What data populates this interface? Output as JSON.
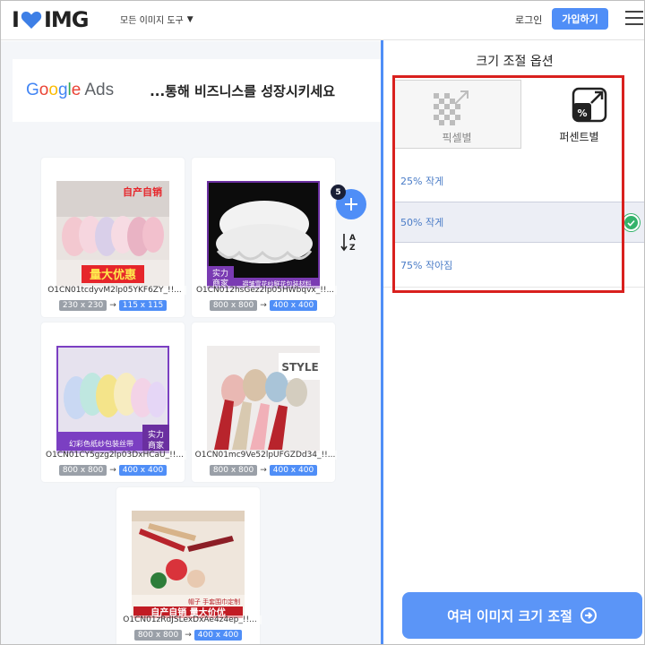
{
  "header": {
    "logo_left": "I",
    "logo_right": "IMG",
    "tools_label": "모든 이미지 도구",
    "login_label": "로그인",
    "signup_label": "가입하기"
  },
  "ad": {
    "logo_letters": [
      "G",
      "o",
      "o",
      "g",
      "l",
      "e"
    ],
    "logo_suffix": "Ads",
    "text": "...통해 비즈니스를 성장시키세요"
  },
  "file_count": "5",
  "cards": [
    {
      "filename": "O1CN01tcdyvM2lp05YKF6ZY_!!...",
      "orig_size": "230 x 230",
      "new_size": "115 x 115"
    },
    {
      "filename": "O1CN012hsGez2lp05HWbqvx_!!...",
      "orig_size": "800 x 800",
      "new_size": "400 x 400"
    },
    {
      "filename": "O1CN01CY5gzg2lp03DxHCaU_!!...",
      "orig_size": "800 x 800",
      "new_size": "400 x 400"
    },
    {
      "filename": "O1CN01mc9Ve52lpUFGZDd34_!!...",
      "orig_size": "800 x 800",
      "new_size": "400 x 400"
    },
    {
      "filename": "O1CN01zRdJSLexDxAe4z4ep_!!...",
      "orig_size": "800 x 800",
      "new_size": "400 x 400"
    }
  ],
  "thumb_text": {
    "card1_banner": "自产自销",
    "card1_badge": "量大优惠",
    "card2_badge": "实力商家",
    "card2_banner": "褶皱雪花纱鲜花包装材料",
    "card3_badge": "实力商家",
    "card3_banner": "幻彩色纸纱包装丝带",
    "card4_sign": "STYLE",
    "card5_banner": "帽子 手套围巾定制",
    "card5_badge": "自产自销 量大价优"
  },
  "panel": {
    "title": "크기 조절 옵션",
    "tab_pixel": "픽셀별",
    "tab_percent": "퍼센트별",
    "options": [
      "25% 작게",
      "50% 작게",
      "75% 작아짐"
    ],
    "selected_option": "50% 작게",
    "resize_button": "여러 이미지 크기 조절"
  },
  "colors": {
    "accent": "#4f8ef7",
    "check": "#34b36b",
    "highlight_box": "#d9201e",
    "heart": "#3d7fe6"
  }
}
